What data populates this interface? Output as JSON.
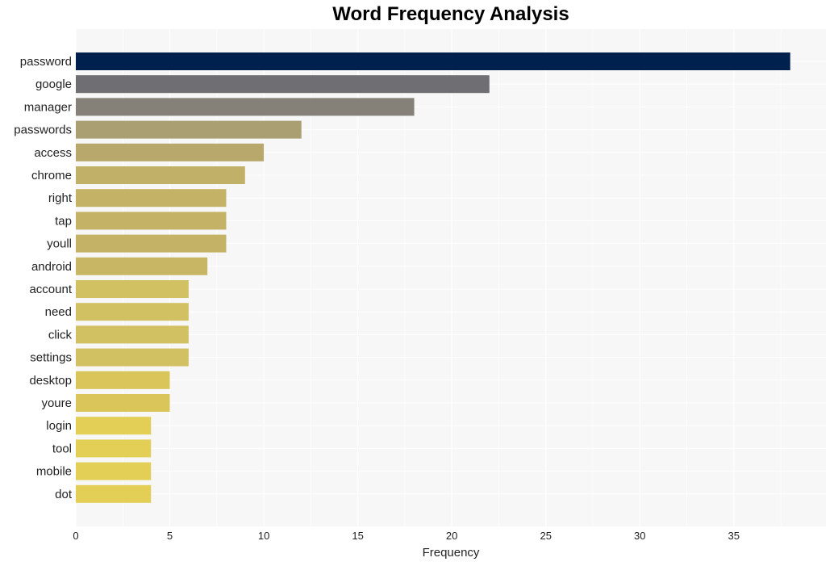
{
  "chart_data": {
    "type": "bar",
    "orientation": "horizontal",
    "title": "Word Frequency Analysis",
    "xlabel": "Frequency",
    "ylabel": "",
    "xlim": [
      0,
      39.9
    ],
    "xticks": [
      0,
      5,
      10,
      15,
      20,
      25,
      30,
      35
    ],
    "grid": true,
    "categories": [
      "password",
      "google",
      "manager",
      "passwords",
      "access",
      "chrome",
      "right",
      "tap",
      "youll",
      "android",
      "account",
      "need",
      "click",
      "settings",
      "desktop",
      "youre",
      "login",
      "tool",
      "mobile",
      "dot"
    ],
    "values": [
      38,
      22,
      18,
      12,
      10,
      9,
      8,
      8,
      8,
      7,
      6,
      6,
      6,
      6,
      5,
      5,
      4,
      4,
      4,
      4
    ],
    "colors": [
      "#00204d",
      "#6e6e73",
      "#858078",
      "#a99f72",
      "#b8a86c",
      "#c1b068",
      "#c4b366",
      "#c4b366",
      "#c4b366",
      "#c8b664",
      "#d2c162",
      "#d2c162",
      "#d2c162",
      "#d2c162",
      "#dac55a",
      "#dac55a",
      "#e3ce56",
      "#e3ce56",
      "#e3ce56",
      "#e3ce56"
    ],
    "background": "#f7f7f7"
  }
}
